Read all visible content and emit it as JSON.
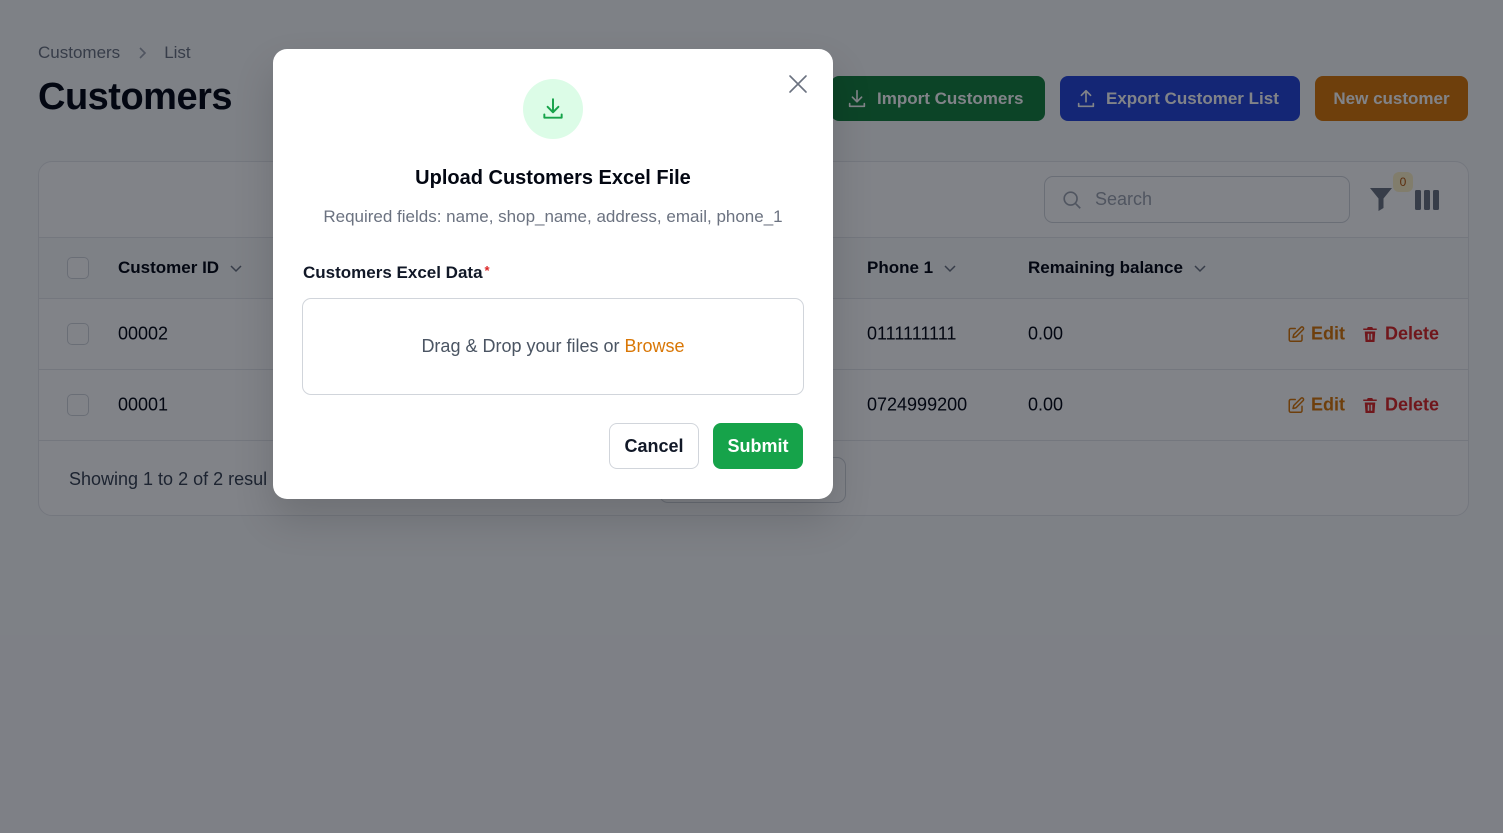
{
  "breadcrumb": {
    "root": "Customers",
    "current": "List"
  },
  "page_title": "Customers",
  "header_actions": {
    "import_label": "Import Customers",
    "export_label": "Export Customer List",
    "new_label": "New customer"
  },
  "toolbar": {
    "search_placeholder": "Search",
    "filter_count": "0"
  },
  "table": {
    "columns": [
      "Customer ID",
      "Phone 1",
      "Remaining balance"
    ],
    "rows": [
      {
        "id": "00002",
        "phone": "0111111111",
        "balance": "0.00",
        "edit": "Edit",
        "delete": "Delete"
      },
      {
        "id": "00001",
        "phone": "0724999200",
        "balance": "0.00",
        "edit": "Edit",
        "delete": "Delete"
      }
    ],
    "footer_text": "Showing 1 to 2 of 2 resul"
  },
  "modal": {
    "title": "Upload Customers Excel File",
    "description": "Required fields: name, shop_name, address, email, phone_1",
    "field_label": "Customers Excel Data",
    "required_mark": "*",
    "dropzone_text": "Drag & Drop your files or",
    "dropzone_link": "Browse",
    "cancel_label": "Cancel",
    "submit_label": "Submit"
  },
  "colors": {
    "import": "#15803d",
    "export": "#2545d9",
    "new": "#d97706",
    "submit": "#16a34a",
    "edit": "#d97706",
    "delete": "#dc2626"
  }
}
